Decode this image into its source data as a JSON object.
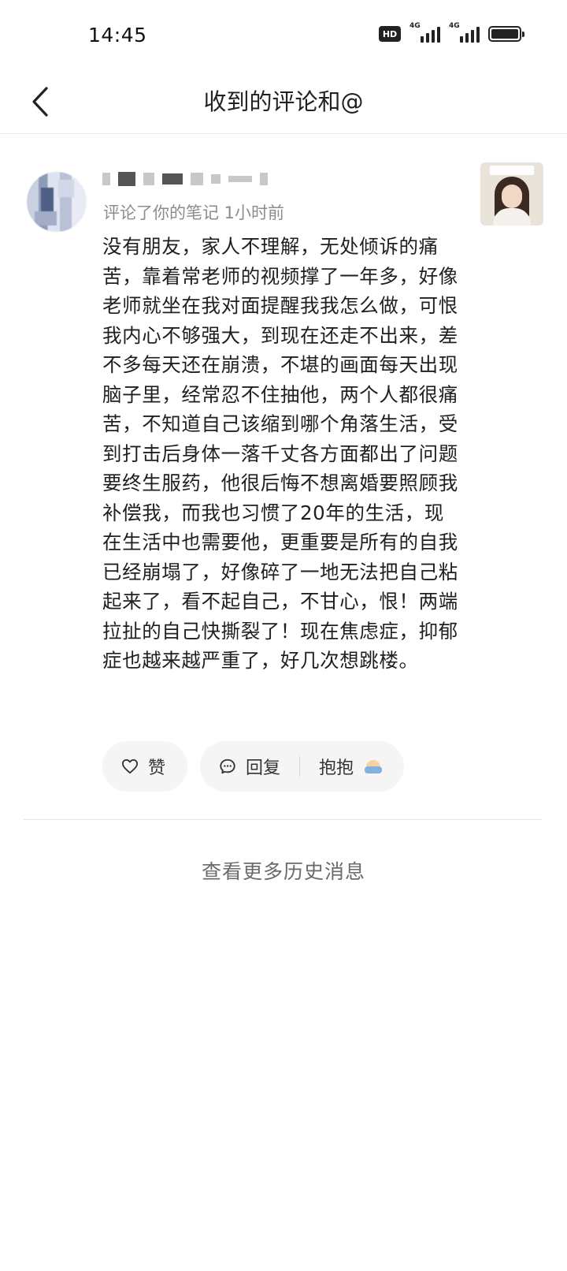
{
  "status_bar": {
    "time": "14:45",
    "hd_label": "HD",
    "signal1_label": "4G",
    "signal2_label": "4G",
    "icons": [
      "hd-icon",
      "signal-icon",
      "signal-icon",
      "battery-icon"
    ]
  },
  "header": {
    "title": "收到的评论和@",
    "back_icon": "chevron-left-icon"
  },
  "comment": {
    "meta": "评论了你的笔记  1小时前",
    "text": "没有朋友，家人不理解，无处倾诉的痛苦，靠着常老师的视频撑了一年多，好像老师就坐在我对面提醒我我怎么做，可恨我内心不够强大，到现在还走不出来，差不多每天还在崩溃，不堪的画面每天出现脑子里，经常忍不住抽他，两个人都很痛苦，不知道自己该缩到哪个角落生活，受到打击后身体一落千丈各方面都出了问题要终生服药，他很后悔不想离婚要照顾我补偿我，而我也习惯了20年的生活，现在生活中也需要他，更重要是所有的自我已经崩塌了，好像碎了一地无法把自己粘起来了，看不起自己，不甘心，恨！两端拉扯的自己快撕裂了！现在焦虑症，抑郁症也越来越严重了，好几次想跳楼。",
    "actions": {
      "like_label": "赞",
      "reply_label": "回复",
      "hug_label": "抱抱"
    }
  },
  "footer": {
    "more_history": "查看更多历史消息"
  },
  "colors": {
    "background": "#ffffff",
    "text": "#1f1f1f",
    "meta": "#8c8c8c",
    "pill_bg": "#f5f5f5",
    "divider": "#e6e6e6"
  }
}
